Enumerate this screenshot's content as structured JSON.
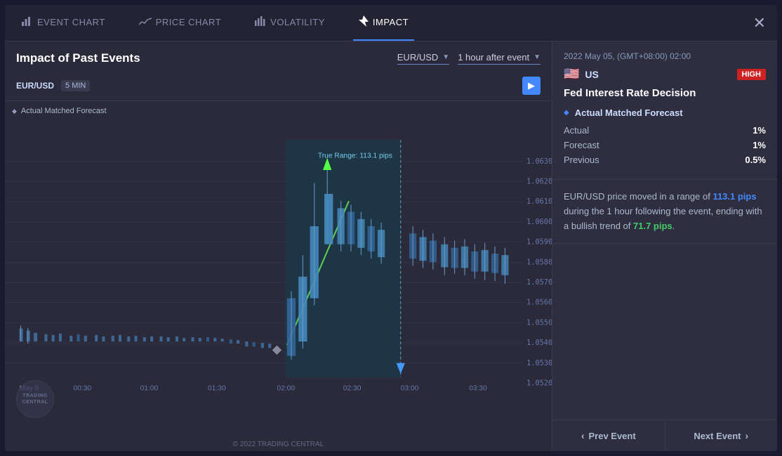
{
  "nav": {
    "items": [
      {
        "id": "event-chart",
        "label": "EVENT CHART",
        "icon": "📊",
        "active": false
      },
      {
        "id": "price-chart",
        "label": "PRICE CHART",
        "icon": "📈",
        "active": false
      },
      {
        "id": "volatility",
        "label": "VOLATILITY",
        "icon": "📉",
        "active": false
      },
      {
        "id": "impact",
        "label": "IMPACT",
        "icon": "⚡",
        "active": true
      }
    ],
    "close_label": "✕"
  },
  "chart_header": {
    "title": "Impact of Past Events",
    "currency_pair": "EUR/USD",
    "time_after": "1 hour after event",
    "ticker": "EUR/USD",
    "timeframe": "5 MIN"
  },
  "chart": {
    "legend_label": "Actual Matched Forecast",
    "true_range_label": "True Range: 113.1 pips",
    "y_axis": [
      "1.06300",
      "1.06200",
      "1.06100",
      "1.06000",
      "1.05900",
      "1.05800",
      "1.05700",
      "1.05600",
      "1.05500",
      "1.05400",
      "1.05300",
      "1.05200"
    ],
    "x_axis": [
      "May 5",
      "00:30",
      "01:00",
      "01:30",
      "02:00",
      "02:30",
      "03:00",
      "03:30"
    ],
    "footer": "© 2022 TRADING CENTRAL"
  },
  "right_panel": {
    "date": "2022 May 05, (GMT+08:00) 02:00",
    "country": "US",
    "flag": "🇺🇸",
    "impact_level": "HIGH",
    "event_title": "Fed Interest Rate Decision",
    "match_label": "Actual Matched Forecast",
    "stats": [
      {
        "key": "Actual",
        "value": "1%"
      },
      {
        "key": "Forecast",
        "value": "1%"
      },
      {
        "key": "Previous",
        "value": "0.5%"
      }
    ],
    "description": "EUR/USD price moved in a range of ",
    "desc_range": "113.1 pips",
    "desc_mid": " during the 1 hour following the event, ending with a bullish trend of ",
    "desc_trend": "71.7 pips",
    "desc_end": ".",
    "prev_label": "Prev Event",
    "next_label": "Next Event"
  }
}
